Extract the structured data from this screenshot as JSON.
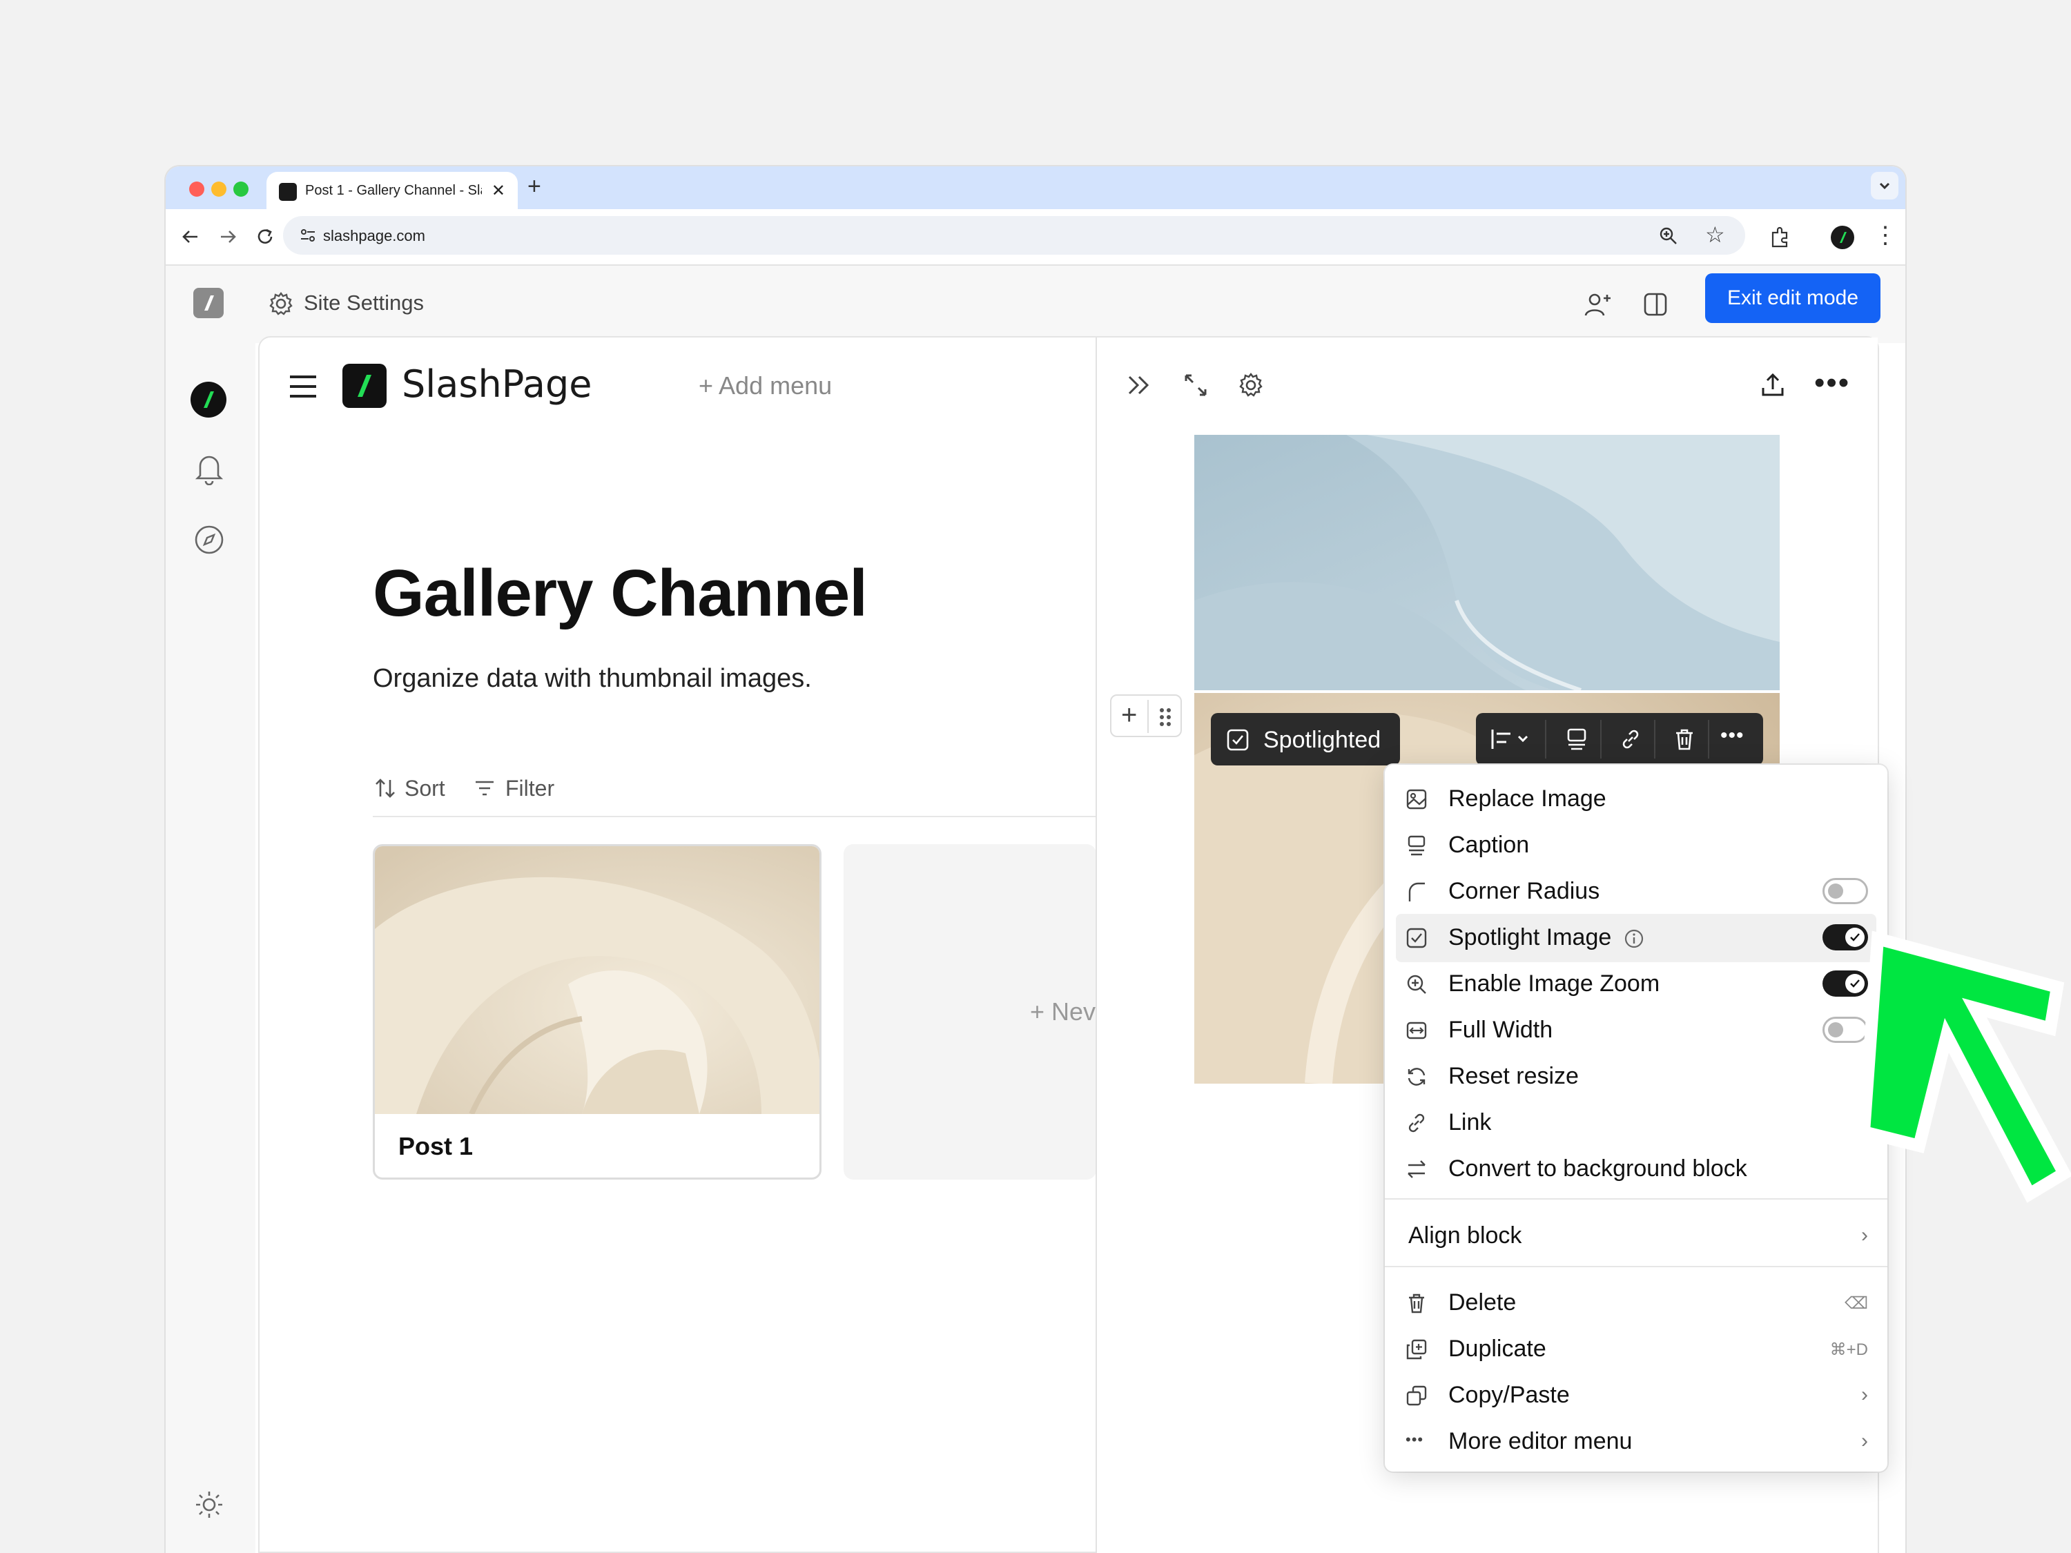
{
  "browser": {
    "tab_title": "Post 1 - Gallery Channel - Sla",
    "url": "slashpage.com"
  },
  "app": {
    "site_settings_label": "Site Settings",
    "exit_edit_label": "Exit edit mode",
    "brand_name": "SlashPage",
    "add_menu_label": "+ Add menu"
  },
  "page": {
    "title": "Gallery Channel",
    "subtitle": "Organize data with thumbnail images.",
    "sort_label": "Sort",
    "filter_label": "Filter",
    "new_card_label": "+ Nev",
    "cards": [
      {
        "label": "Post 1"
      }
    ]
  },
  "block_toolbar": {
    "spotlighted_label": "Spotlighted"
  },
  "context_menu": {
    "items": [
      {
        "label": "Replace Image",
        "icon": "image-icon"
      },
      {
        "label": "Caption",
        "icon": "caption-icon"
      },
      {
        "label": "Corner Radius",
        "icon": "corner-icon",
        "toggle": false
      },
      {
        "label": "Spotlight Image",
        "icon": "check-square-icon",
        "toggle": true,
        "highlighted": true
      },
      {
        "label": "Enable Image Zoom",
        "icon": "zoom-in-icon",
        "toggle": true
      },
      {
        "label": "Full Width",
        "icon": "full-width-icon",
        "toggle": false
      },
      {
        "label": "Reset resize",
        "icon": "refresh-icon"
      },
      {
        "label": "Link",
        "icon": "link-icon"
      },
      {
        "label": "Convert to background block",
        "icon": "swap-icon"
      }
    ],
    "align_label": "Align block",
    "actions": [
      {
        "label": "Delete",
        "icon": "trash-icon",
        "shortcut": "⌫"
      },
      {
        "label": "Duplicate",
        "icon": "duplicate-icon",
        "shortcut": "⌘+D"
      },
      {
        "label": "Copy/Paste",
        "icon": "copy-icon",
        "submenu": true
      },
      {
        "label": "More editor menu",
        "icon": "more-icon",
        "submenu": true
      }
    ]
  },
  "colors": {
    "accent_blue": "#1463f5",
    "brand_green": "#22dd55",
    "arrow_green": "#00e641",
    "tab_bar": "#d3e3fd"
  }
}
